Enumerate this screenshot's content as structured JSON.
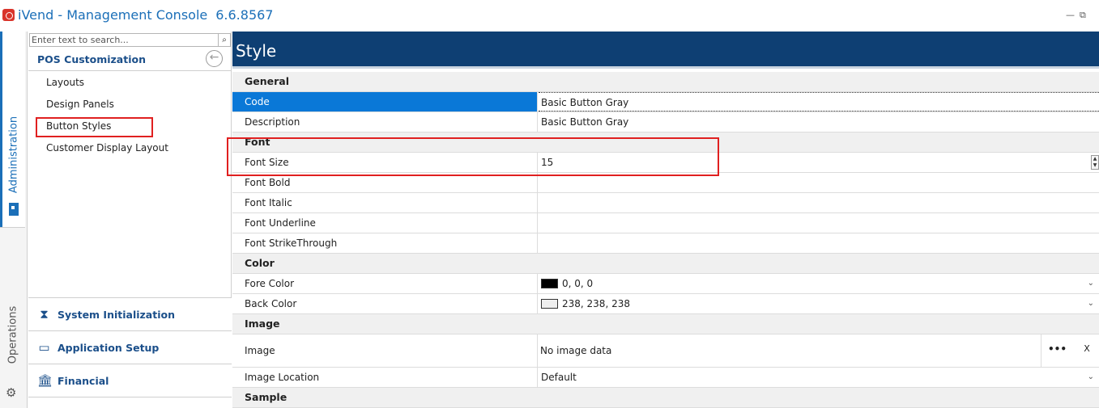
{
  "window": {
    "title": "iVend - Management Console",
    "version": "6.6.8567",
    "minimize_glyph": "—",
    "restore_glyph": "⧉"
  },
  "vnav": {
    "tabs": [
      {
        "label": "Administration",
        "icon": "admin-icon",
        "active": true
      },
      {
        "label": "Operations",
        "icon": "gear-icon",
        "active": false
      }
    ]
  },
  "sidebar": {
    "search_placeholder": "Enter text to search...",
    "section_title": "POS Customization",
    "items": [
      {
        "label": "Layouts"
      },
      {
        "label": "Design Panels"
      },
      {
        "label": "Button Styles",
        "highlighted": true
      },
      {
        "label": "Customer Display Layout"
      }
    ],
    "accordion": [
      {
        "label": "System Initialization",
        "icon": "hourglass-icon"
      },
      {
        "label": "Application Setup",
        "icon": "terminal-icon"
      },
      {
        "label": "Financial",
        "icon": "bank-icon"
      }
    ]
  },
  "main": {
    "title": "Style",
    "categories": {
      "general": "General",
      "font": "Font",
      "color": "Color",
      "image": "Image",
      "sample": "Sample"
    },
    "properties": {
      "code": {
        "name": "Code",
        "value": "Basic Button Gray"
      },
      "description": {
        "name": "Description",
        "value": "Basic Button Gray"
      },
      "font_size": {
        "name": "Font Size",
        "value": "15"
      },
      "font_bold": {
        "name": "Font Bold",
        "checked": false
      },
      "font_italic": {
        "name": "Font Italic",
        "checked": false
      },
      "font_underline": {
        "name": "Font Underline",
        "checked": false
      },
      "font_strikethrough": {
        "name": "Font StrikeThrough",
        "checked": false
      },
      "fore_color": {
        "name": "Fore Color",
        "value": "0, 0, 0",
        "swatch": "#000000"
      },
      "back_color": {
        "name": "Back Color",
        "value": "238, 238, 238",
        "swatch": "#eeeeee"
      },
      "image": {
        "name": "Image",
        "value": "No image data",
        "browse_label": "•••",
        "clear_label": "X"
      },
      "image_location": {
        "name": "Image Location",
        "value": "Default"
      }
    }
  },
  "colors": {
    "accent": "#1b6fb8",
    "header_bg": "#0e3f73",
    "selection": "#0a78d7",
    "highlight": "#e02020"
  }
}
